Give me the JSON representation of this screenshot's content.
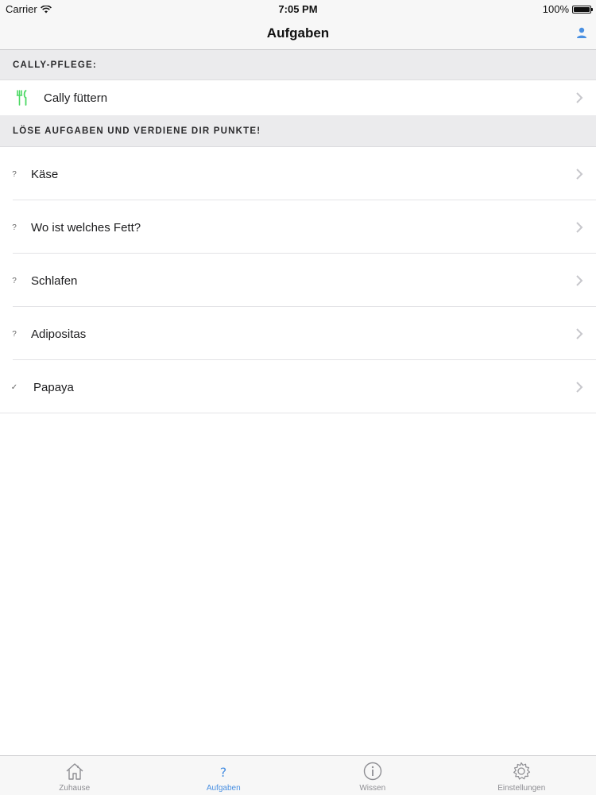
{
  "status": {
    "carrier": "Carrier",
    "time": "7:05 PM",
    "battery": "100%",
    "battery_level": 1.0
  },
  "nav": {
    "title": "Aufgaben"
  },
  "sections": [
    {
      "header": "CALLY-PFLEGE:"
    },
    {
      "header": "LÖSE AUFGABEN UND VERDIENE DIR PUNKTE!"
    }
  ],
  "care_item": {
    "label": "Cally füttern",
    "icon": "fork-knife-icon"
  },
  "tasks": [
    {
      "label": "Käse",
      "mark": "?"
    },
    {
      "label": "Wo ist welches Fett?",
      "mark": "?"
    },
    {
      "label": "Schlafen",
      "mark": "?"
    },
    {
      "label": "Adipositas",
      "mark": "?"
    },
    {
      "label": "Papaya",
      "mark": "✓"
    }
  ],
  "tabs": [
    {
      "label": "Zuhause",
      "icon": "home-icon"
    },
    {
      "label": "Aufgaben",
      "icon": "question-icon"
    },
    {
      "label": "Wissen",
      "icon": "info-icon"
    },
    {
      "label": "Einstellungen",
      "icon": "gear-icon"
    }
  ],
  "colors": {
    "accent": "#4a90e2",
    "care_icon": "#4cd964",
    "inactive": "#8e8e93"
  }
}
